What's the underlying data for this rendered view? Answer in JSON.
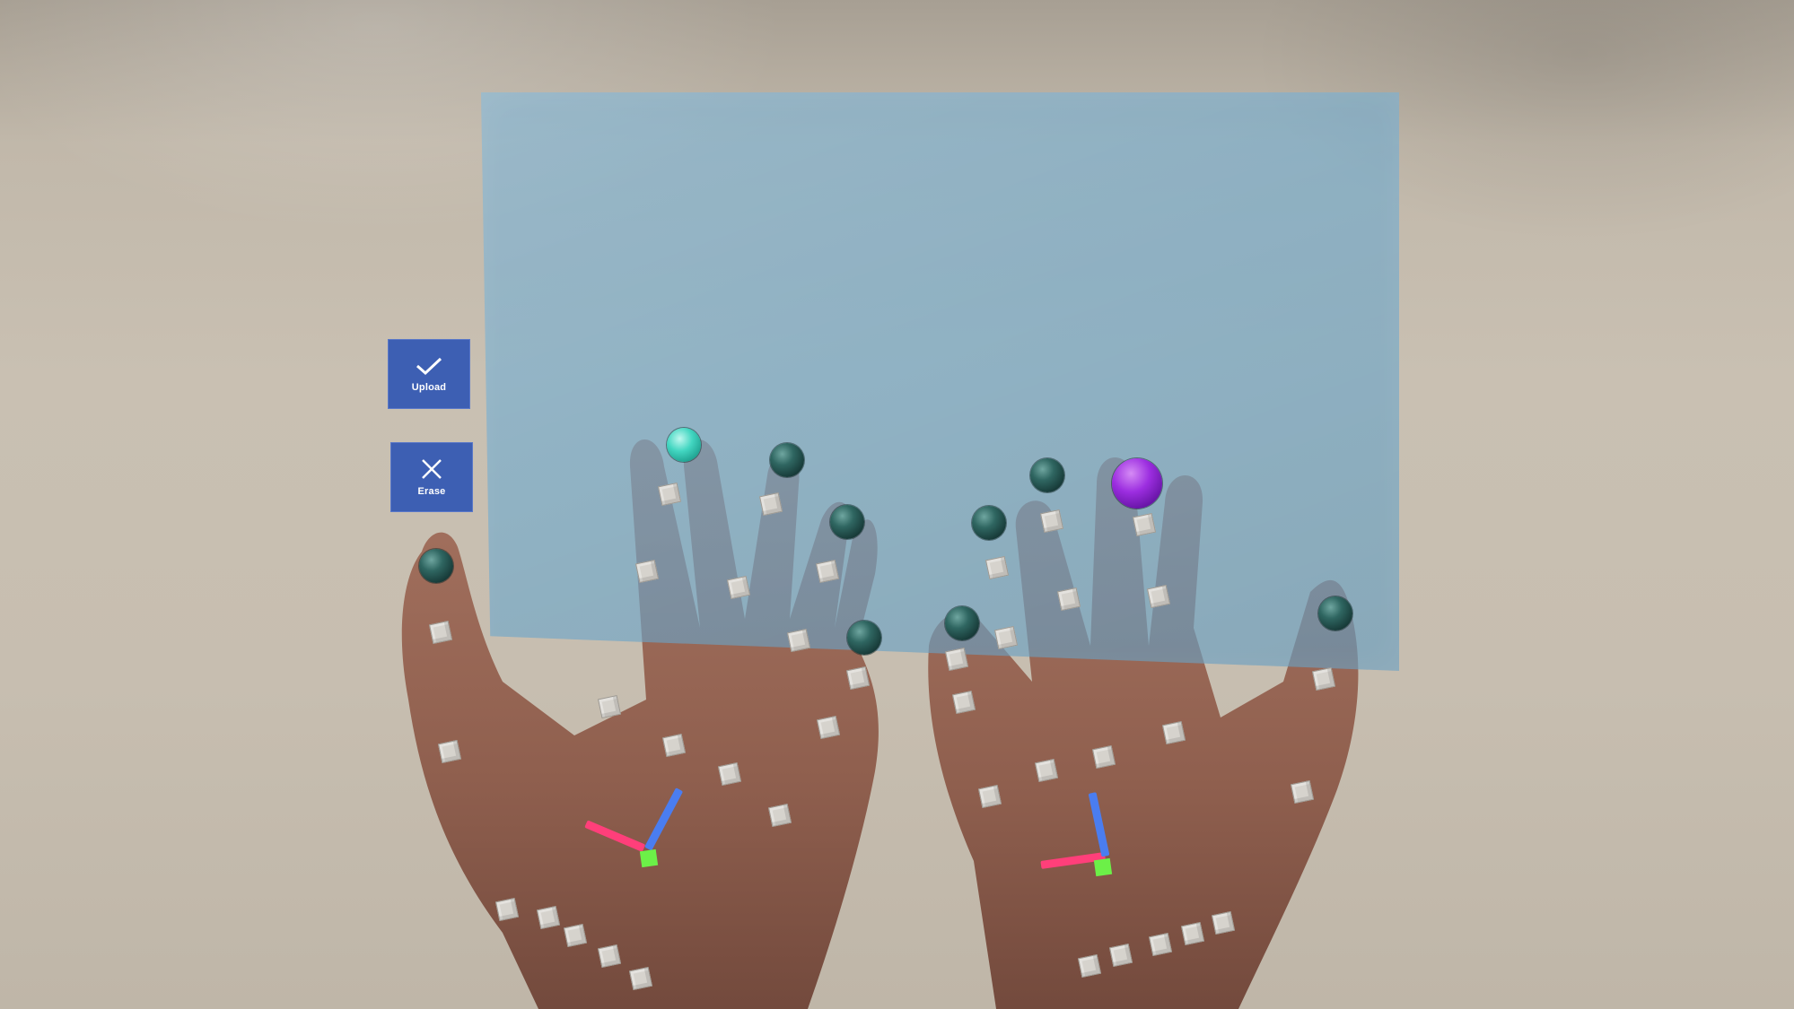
{
  "buttons": {
    "upload": {
      "label": "Upload",
      "icon": "checkmark-icon"
    },
    "erase": {
      "label": "Erase",
      "icon": "close-icon"
    }
  },
  "slate": {
    "color": "#6daacf"
  },
  "hand_tracking": {
    "finger_tip_color": "#2f6661",
    "active_tip_colors": [
      "#42d6c1",
      "#9c2ee0"
    ],
    "joint_color": "#d6d3cd",
    "axis_colors": {
      "x": "#ff3f7a",
      "y": "#4a7df0",
      "z": "#6cf048"
    }
  }
}
